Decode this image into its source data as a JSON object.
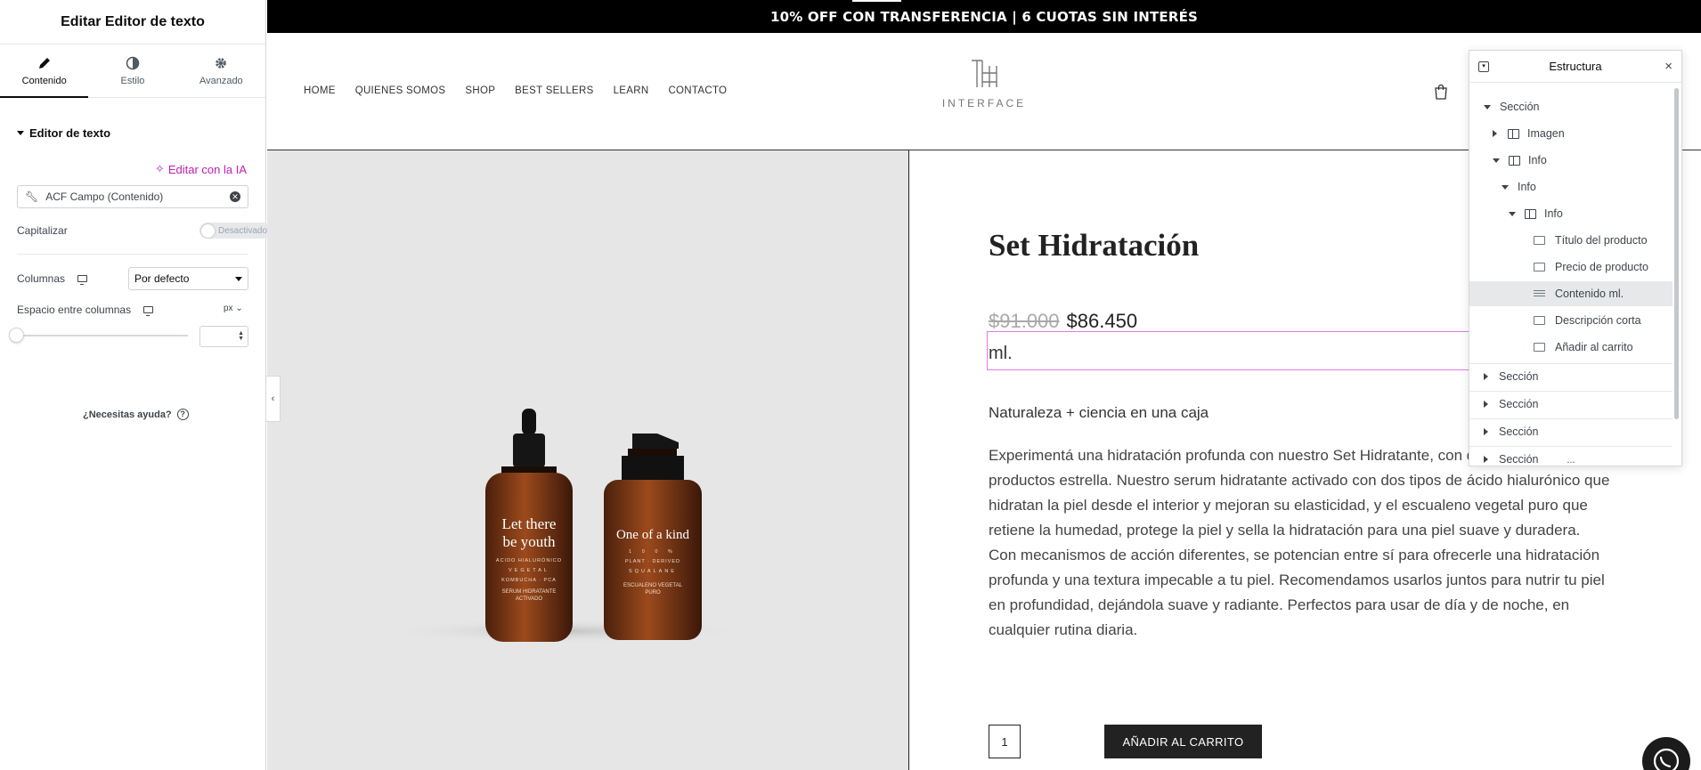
{
  "editor": {
    "title": "Editar Editor de texto",
    "tabs": [
      {
        "label": "Contenido",
        "icon": "pencil-icon"
      },
      {
        "label": "Estilo",
        "icon": "half-circle-icon"
      },
      {
        "label": "Avanzado",
        "icon": "gear-icon"
      }
    ],
    "section_title": "Editor de texto",
    "ai_link": "Editar con la IA",
    "dynamic_field": "ACF Campo (Contenido)",
    "capitalize_label": "Capitalizar",
    "capitalize_toggle": "Desactivado",
    "columns_label": "Columnas",
    "columns_value": "Por defecto",
    "column_gap_label": "Espacio entre columnas",
    "unit": "px",
    "help": "¿Necesitas ayuda?",
    "colors": {
      "ai_accent": "#c11eb0"
    }
  },
  "site": {
    "announcement": "10% OFF CON TRANSFERENCIA | 6 CUOTAS SIN INTERÉS",
    "nav": [
      "HOME",
      "QUIENES SOMOS",
      "SHOP",
      "BEST SELLERS",
      "LEARN",
      "CONTACTO"
    ],
    "logo_text": "INTERFACE",
    "product": {
      "title": "Set Hidratación",
      "old_price": "$91.000",
      "price": "$86.450",
      "content_ml": "ml.",
      "tagline": "Naturaleza + ciencia en una caja",
      "description": "Experimentá una hidratación profunda con nuestro Set Hidratante, con dos de nuestros productos estrella. Nuestro serum hidratante activado con dos tipos de ácido hialurónico que hidratan la piel desde el interior y mejoran su elasticidad, y el escualeno vegetal puro que retiene la humedad, protege la piel y sella la hidratación para una piel suave y duradera. Con mecanismos de acción diferentes, se potencian entre sí para ofrecerle una hidratación profunda y una textura impecable a tu piel. Recomendamos usarlos juntos para nutrir tu piel en profundidad, dejándola suave y radiante. Perfectos para usar de día y de noche, en cualquier rutina diaria.",
      "quantity": "1",
      "add_to_cart": "AÑADIR AL CARRITO",
      "bottle_left": {
        "line1": "Let there",
        "line2": "be youth",
        "small1": "ACIDO HIALURÓNICO",
        "small2": "VEGETAL",
        "small3": "KOMBUCHA · PCA",
        "bottom1": "SERUM HIDRATANTE",
        "bottom2": "ACTIVADO"
      },
      "bottle_right": {
        "line1": "One of a kind",
        "small1": "1 0 0 %",
        "small2": "PLANT · DERIVED",
        "small3": "SQUALANE",
        "bottom1": "ESCUALENO VEGETAL",
        "bottom2": "PURO"
      }
    }
  },
  "navigator": {
    "title": "Estructura",
    "items": [
      {
        "label": "Sección",
        "level": 0,
        "expanded": true,
        "icon": "none"
      },
      {
        "label": "Imagen",
        "level": 1,
        "expanded": false,
        "icon": "column-icon"
      },
      {
        "label": "Info",
        "level": 1,
        "expanded": true,
        "icon": "column-icon"
      },
      {
        "label": "Info",
        "level": 2,
        "expanded": true,
        "icon": "none"
      },
      {
        "label": "Info",
        "level": 3,
        "expanded": true,
        "icon": "column-icon"
      },
      {
        "label": "Título del producto",
        "level": 4,
        "icon": "widget-title-icon"
      },
      {
        "label": "Precio de producto",
        "level": 4,
        "icon": "widget-price-icon"
      },
      {
        "label": "Contenido ml.",
        "level": 4,
        "icon": "text-editor-icon",
        "selected": true
      },
      {
        "label": "Descripción corta",
        "level": 4,
        "icon": "widget-description-icon"
      },
      {
        "label": "Añadir al carrito",
        "level": 4,
        "icon": "widget-cart-icon"
      },
      {
        "label": "Sección",
        "level": 0,
        "expanded": false,
        "icon": "none"
      },
      {
        "label": "Sección",
        "level": 0,
        "expanded": false,
        "icon": "none"
      },
      {
        "label": "Sección",
        "level": 0,
        "expanded": false,
        "icon": "none"
      },
      {
        "label": "Sección",
        "level": 0,
        "expanded": false,
        "icon": "none"
      }
    ],
    "more": "..."
  }
}
